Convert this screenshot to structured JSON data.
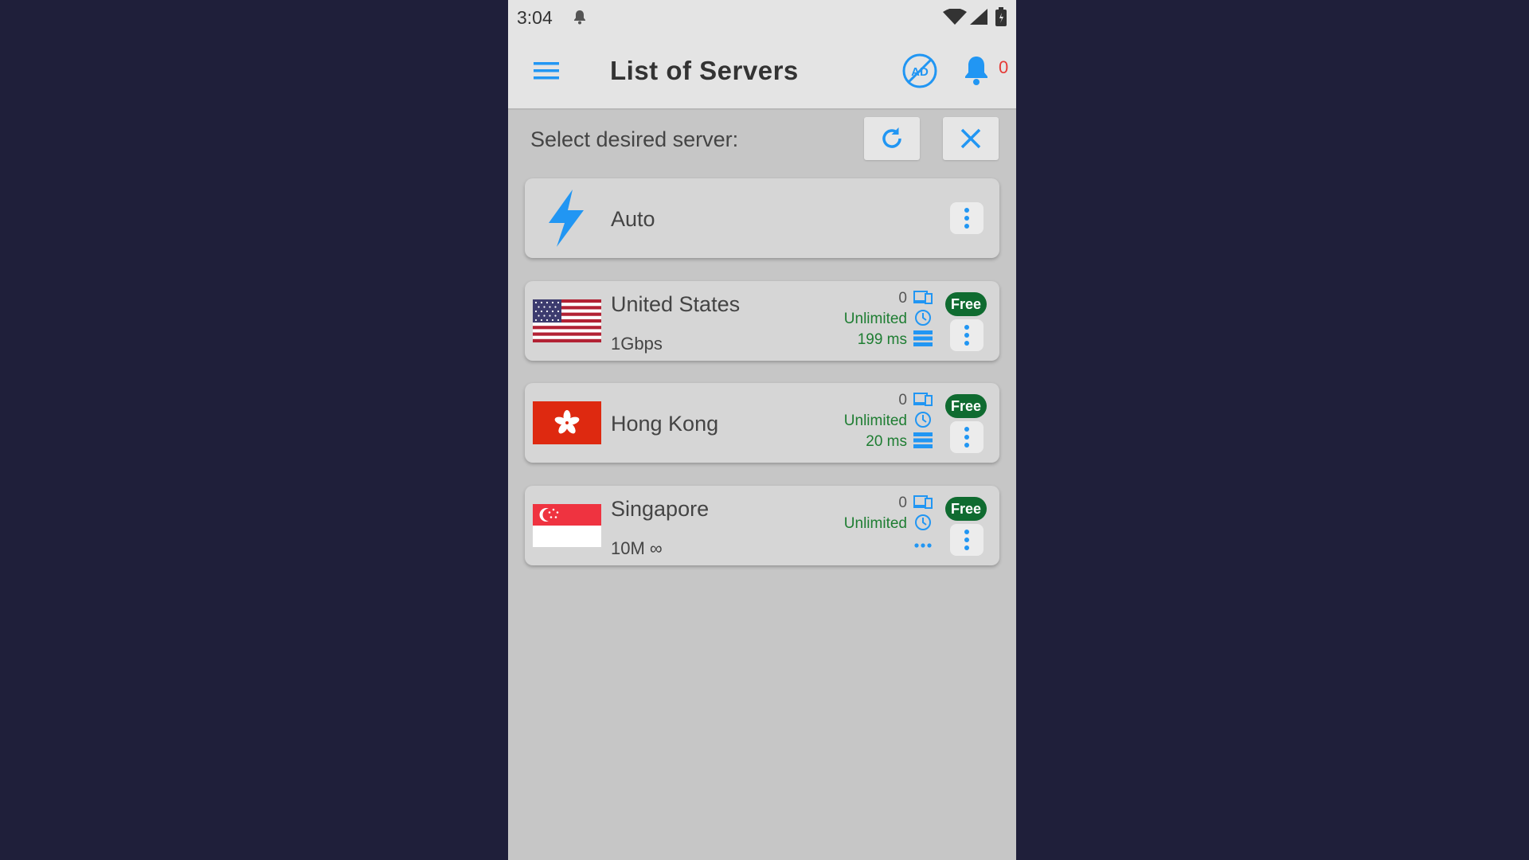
{
  "status_bar": {
    "time": "3:04"
  },
  "app_bar": {
    "title": "List of Servers",
    "notification_count": "0"
  },
  "toolbar": {
    "select_label": "Select desired server:"
  },
  "auto_server": {
    "label": "Auto"
  },
  "servers": [
    {
      "name": "United States",
      "subtitle": "1Gbps",
      "users": "0",
      "time_limit": "Unlimited",
      "latency": "199 ms",
      "badge": "Free",
      "flag": "us"
    },
    {
      "name": "Hong Kong",
      "subtitle": "",
      "users": "0",
      "time_limit": "Unlimited",
      "latency": "20 ms",
      "badge": "Free",
      "flag": "hk"
    },
    {
      "name": "Singapore",
      "subtitle": "10M ∞",
      "users": "0",
      "time_limit": "Unlimited",
      "latency": "",
      "badge": "Free",
      "flag": "sg"
    }
  ],
  "colors": {
    "accent": "#2196f3",
    "free_badge": "#0f6b30",
    "green_text": "#1e7d32",
    "notification": "#e53935",
    "outer_background": "#1f1f3a"
  },
  "icons": {
    "status": [
      "bell-icon",
      "wifi-icon",
      "signal-icon",
      "battery-icon"
    ],
    "app_bar": [
      "hamburger-menu-icon",
      "no-ads-icon",
      "notification-bell-icon"
    ],
    "toolbar": [
      "refresh-icon",
      "close-icon"
    ],
    "stats": [
      "devices-icon",
      "clock-icon",
      "server-icon",
      "ellipsis-icon"
    ],
    "card": [
      "lightning-bolt-icon",
      "kebab-menu-icon"
    ]
  }
}
